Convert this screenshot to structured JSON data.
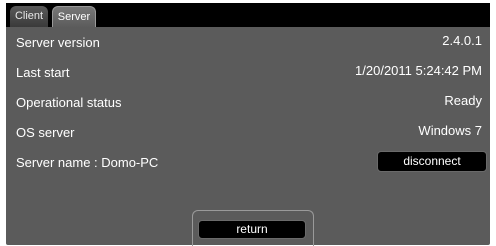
{
  "tabs": [
    {
      "label": "Client",
      "active": false
    },
    {
      "label": "Server",
      "active": true
    }
  ],
  "info": {
    "server_version": {
      "label": "Server version",
      "value": "2.4.0.1"
    },
    "last_start": {
      "label": "Last start",
      "value": "1/20/2011 5:24:42 PM"
    },
    "operational_status": {
      "label": "Operational status",
      "value": "Ready"
    },
    "os_server": {
      "label": "OS server",
      "value": "Windows 7"
    },
    "server_name": {
      "label": "Server name : Domo-PC"
    }
  },
  "buttons": {
    "disconnect": "disconnect",
    "return": "return"
  },
  "colors": {
    "panel": "#5b5b5b",
    "tab_bar": "#000000",
    "button": "#000000",
    "text": "#ffffff"
  }
}
